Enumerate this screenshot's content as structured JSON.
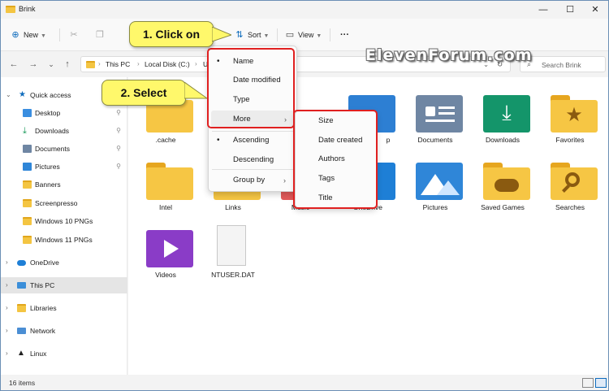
{
  "window": {
    "title": "Brink"
  },
  "titlebar": {
    "minimize": "—",
    "maximize": "☐",
    "close": "✕"
  },
  "toolbar": {
    "new_label": "New",
    "sort_label": "Sort",
    "view_label": "View",
    "more_label": "···",
    "cut_icon": "✂",
    "copy_icon": "❐"
  },
  "nav": {
    "back": "←",
    "forward": "→",
    "recent": "⌄",
    "up": "↑"
  },
  "address": {
    "crumbs": [
      "This PC",
      "Local Disk (C:)",
      "U"
    ],
    "refresh": "↻",
    "dropdown": "⌄"
  },
  "search": {
    "placeholder": "Search Brink"
  },
  "sidebar": {
    "items": [
      {
        "label": "Quick access",
        "pinned": false
      },
      {
        "label": "Desktop",
        "pinned": true
      },
      {
        "label": "Downloads",
        "pinned": true
      },
      {
        "label": "Documents",
        "pinned": true
      },
      {
        "label": "Pictures",
        "pinned": true
      },
      {
        "label": "Banners",
        "pinned": false
      },
      {
        "label": "Screenpresso",
        "pinned": false
      },
      {
        "label": "Windows 10 PNGs",
        "pinned": false
      },
      {
        "label": "Windows 11 PNGs",
        "pinned": false
      },
      {
        "label": "OneDrive",
        "pinned": false
      },
      {
        "label": "This PC",
        "pinned": false
      },
      {
        "label": "Libraries",
        "pinned": false
      },
      {
        "label": "Network",
        "pinned": false
      },
      {
        "label": "Linux",
        "pinned": false
      }
    ],
    "pin_glyph": "📌"
  },
  "files": [
    {
      "label": ".cache"
    },
    {
      "label": "Documents"
    },
    {
      "label": "Downloads"
    },
    {
      "label": "Favorites"
    },
    {
      "label": "Intel"
    },
    {
      "label": "Links"
    },
    {
      "label": "Music"
    },
    {
      "label": "OneDrive"
    },
    {
      "label": "Pictures"
    },
    {
      "label": "Saved Games"
    },
    {
      "label": "Searches"
    },
    {
      "label": "Videos"
    },
    {
      "label": "NTUSER.DAT"
    },
    {
      "label": "p"
    }
  ],
  "sort_menu": {
    "items": [
      {
        "label": "Name",
        "checked": true
      },
      {
        "label": "Date modified",
        "checked": false
      },
      {
        "label": "Type",
        "checked": false
      },
      {
        "label": "More",
        "submenu": true
      },
      {
        "label": "Ascending",
        "checked": true
      },
      {
        "label": "Descending",
        "checked": false
      },
      {
        "label": "Group by",
        "submenu": true
      }
    ],
    "bullet": "•",
    "arrow": "›"
  },
  "more_menu": {
    "items": [
      {
        "label": "Size"
      },
      {
        "label": "Date created"
      },
      {
        "label": "Authors"
      },
      {
        "label": "Tags"
      },
      {
        "label": "Title"
      }
    ]
  },
  "callouts": {
    "step1": "1. Click on",
    "step2": "2. Select"
  },
  "watermark": "ElevenForum.com",
  "status": {
    "count": "16 items"
  },
  "colors": {
    "accent": "#0f6cbd",
    "highlight": "#e02020",
    "callout": "#fff86b"
  }
}
